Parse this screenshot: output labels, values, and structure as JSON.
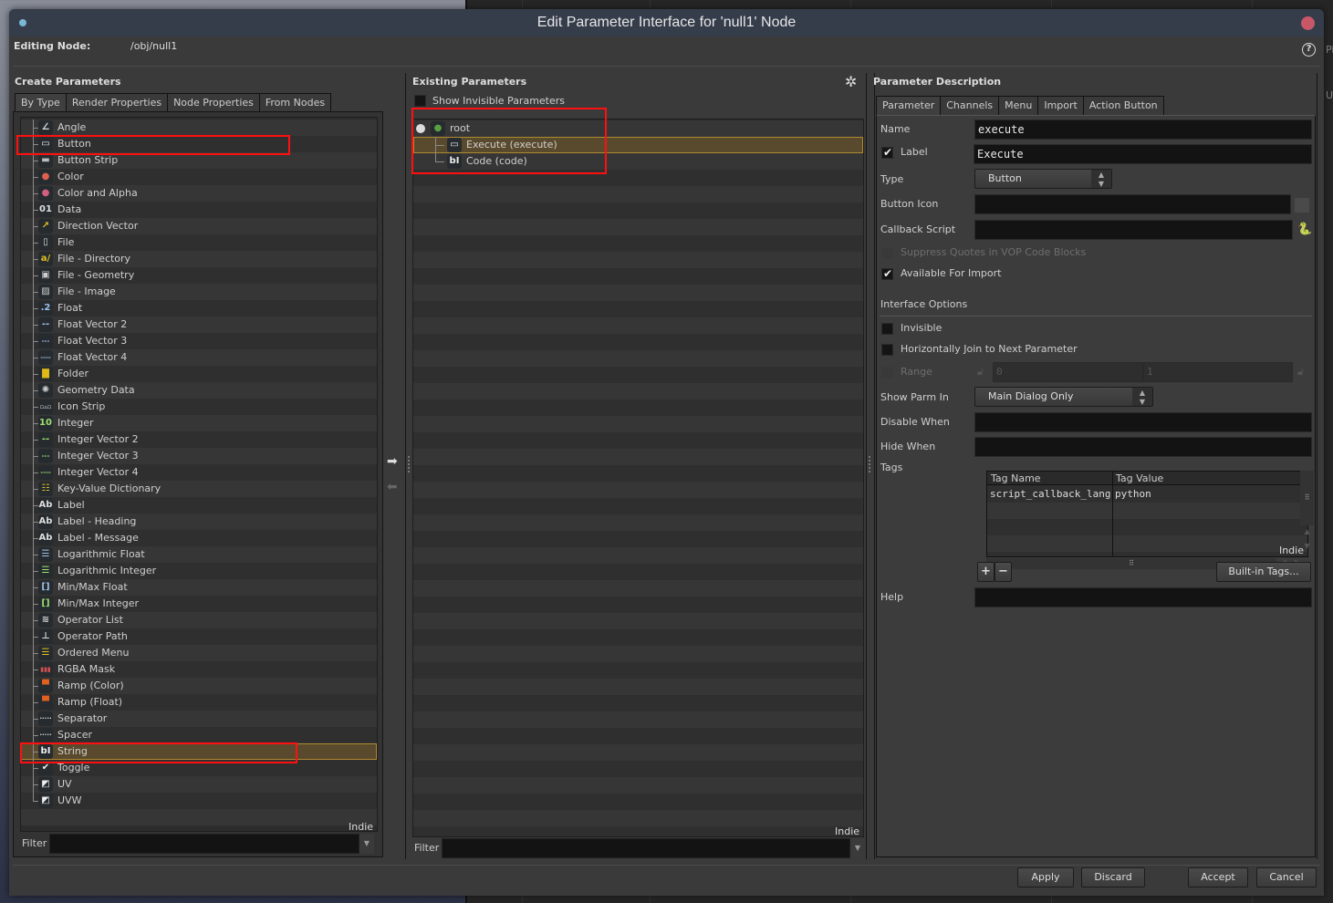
{
  "dialog": {
    "title": "Edit Parameter Interface for 'null1' Node",
    "editing_node_label": "Editing Node:",
    "editing_node_value": "/obj/null1",
    "help_icon": "?"
  },
  "background": {
    "side_text_1": "Pi",
    "side_text_2": "U"
  },
  "create_parameters": {
    "title": "Create Parameters",
    "tabs": [
      "By Type",
      "Render Properties",
      "Node Properties",
      "From Nodes"
    ],
    "active_tab": "By Type",
    "items": [
      {
        "label": "Angle",
        "icon": "angle-icon",
        "glyph": "∠",
        "color": "#ddd"
      },
      {
        "label": "Button",
        "icon": "button-icon",
        "glyph": "▭",
        "color": "#eee",
        "highlighted": true
      },
      {
        "label": "Button Strip",
        "icon": "button-strip-icon",
        "glyph": "▬",
        "color": "#bbb"
      },
      {
        "label": "Color",
        "icon": "color-icon",
        "glyph": "●",
        "color": "#e06050"
      },
      {
        "label": "Color and Alpha",
        "icon": "color-alpha-icon",
        "glyph": "●",
        "color": "#d06080"
      },
      {
        "label": "Data",
        "icon": "data-icon",
        "glyph": "01",
        "color": "#ddd"
      },
      {
        "label": "Direction Vector",
        "icon": "direction-vector-icon",
        "glyph": "↗",
        "color": "#e0c020"
      },
      {
        "label": "File",
        "icon": "file-icon",
        "glyph": "▯",
        "color": "#ddd"
      },
      {
        "label": "File - Directory",
        "icon": "file-directory-icon",
        "glyph": "a/",
        "color": "#e0c020"
      },
      {
        "label": "File - Geometry",
        "icon": "file-geometry-icon",
        "glyph": "▣",
        "color": "#ccc"
      },
      {
        "label": "File - Image",
        "icon": "file-image-icon",
        "glyph": "▨",
        "color": "#ccc"
      },
      {
        "label": "Float",
        "icon": "float-icon",
        "glyph": ".2",
        "color": "#9fc2e8"
      },
      {
        "label": "Float Vector 2",
        "icon": "float-vector2-icon",
        "glyph": "--",
        "color": "#9fc2e8"
      },
      {
        "label": "Float Vector 3",
        "icon": "float-vector3-icon",
        "glyph": "---",
        "color": "#9fc2e8"
      },
      {
        "label": "Float Vector 4",
        "icon": "float-vector4-icon",
        "glyph": "----",
        "color": "#9fc2e8"
      },
      {
        "label": "Folder",
        "icon": "folder-icon",
        "glyph": "▇",
        "color": "#e0b818"
      },
      {
        "label": "Geometry Data",
        "icon": "geometry-data-icon",
        "glyph": "✺",
        "color": "#ccc"
      },
      {
        "label": "Icon Strip",
        "icon": "icon-strip-icon",
        "glyph": "▫▵▫",
        "color": "#ddd"
      },
      {
        "label": "Integer",
        "icon": "integer-icon",
        "glyph": "10",
        "color": "#9ee070"
      },
      {
        "label": "Integer Vector 2",
        "icon": "integer-vector2-icon",
        "glyph": "--",
        "color": "#9ee070"
      },
      {
        "label": "Integer Vector 3",
        "icon": "integer-vector3-icon",
        "glyph": "---",
        "color": "#9ee070"
      },
      {
        "label": "Integer Vector 4",
        "icon": "integer-vector4-icon",
        "glyph": "----",
        "color": "#9ee070"
      },
      {
        "label": "Key-Value Dictionary",
        "icon": "key-value-dictionary-icon",
        "glyph": "☷",
        "color": "#e0c020"
      },
      {
        "label": "Label",
        "icon": "label-icon",
        "glyph": "Ab",
        "color": "#ddd"
      },
      {
        "label": "Label - Heading",
        "icon": "label-heading-icon",
        "glyph": "Ab",
        "color": "#ddd"
      },
      {
        "label": "Label - Message",
        "icon": "label-message-icon",
        "glyph": "Ab",
        "color": "#ddd"
      },
      {
        "label": "Logarithmic Float",
        "icon": "log-float-icon",
        "glyph": "☰",
        "color": "#9fc2e8"
      },
      {
        "label": "Logarithmic Integer",
        "icon": "log-integer-icon",
        "glyph": "☰",
        "color": "#9ee070"
      },
      {
        "label": "Min/Max Float",
        "icon": "minmax-float-icon",
        "glyph": "[]",
        "color": "#9fc2e8"
      },
      {
        "label": "Min/Max Integer",
        "icon": "minmax-integer-icon",
        "glyph": "[]",
        "color": "#9ee070"
      },
      {
        "label": "Operator List",
        "icon": "operator-list-icon",
        "glyph": "≋",
        "color": "#ddd"
      },
      {
        "label": "Operator Path",
        "icon": "operator-path-icon",
        "glyph": "⊥",
        "color": "#ddd"
      },
      {
        "label": "Ordered Menu",
        "icon": "ordered-menu-icon",
        "glyph": "☰",
        "color": "#e0c020"
      },
      {
        "label": "RGBA Mask",
        "icon": "rgba-mask-icon",
        "glyph": "▮▮▮",
        "color": "#d05050"
      },
      {
        "label": "Ramp (Color)",
        "icon": "ramp-color-icon",
        "glyph": "▀",
        "color": "#e06020"
      },
      {
        "label": "Ramp (Float)",
        "icon": "ramp-float-icon",
        "glyph": "▀",
        "color": "#e06020"
      },
      {
        "label": "Separator",
        "icon": "separator-icon",
        "glyph": "·····",
        "color": "#ddd"
      },
      {
        "label": "Spacer",
        "icon": "spacer-icon",
        "glyph": "·····",
        "color": "#ddd"
      },
      {
        "label": "String",
        "icon": "string-icon",
        "glyph": "bI",
        "color": "#eee",
        "selected": true,
        "highlighted": true
      },
      {
        "label": "Toggle",
        "icon": "toggle-icon",
        "glyph": "✔",
        "color": "#eee"
      },
      {
        "label": "UV",
        "icon": "uv-icon",
        "glyph": "◩",
        "color": "#eee"
      },
      {
        "label": "UVW",
        "icon": "uvw-icon",
        "glyph": "◩",
        "color": "#eee"
      }
    ],
    "indie_label": "Indie",
    "filter_label": "Filter",
    "filter_value": ""
  },
  "existing_parameters": {
    "title": "Existing Parameters",
    "show_invisible_label": "Show Invisible Parameters",
    "show_invisible_checked": false,
    "tree": [
      {
        "label": "root",
        "icon": "globe-icon",
        "glyph": "●",
        "color": "#5aa040",
        "depth": 0
      },
      {
        "label": "Execute (execute)",
        "icon": "button-icon",
        "glyph": "▭",
        "color": "#eee",
        "depth": 1,
        "selected": true
      },
      {
        "label": "Code (code)",
        "icon": "string-icon",
        "glyph": "bI",
        "color": "#eee",
        "depth": 1
      }
    ],
    "indie_label": "Indie",
    "filter_label": "Filter",
    "filter_value": ""
  },
  "parameter_description": {
    "title": "Parameter Description",
    "tabs": [
      "Parameter",
      "Channels",
      "Menu",
      "Import",
      "Action Button"
    ],
    "active_tab": "Parameter",
    "name_label": "Name",
    "name_value": "execute",
    "label_label": "Label",
    "label_checked": true,
    "label_value": "Execute",
    "type_label": "Type",
    "type_value": "Button",
    "button_icon_label": "Button Icon",
    "button_icon_value": "",
    "callback_label": "Callback Script",
    "callback_value": "",
    "suppress_quotes_label": "Suppress Quotes in VOP Code Blocks",
    "suppress_quotes_checked": false,
    "available_import_label": "Available For Import",
    "available_import_checked": true,
    "interface_options_label": "Interface Options",
    "invisible_label": "Invisible",
    "invisible_checked": false,
    "hjoin_label": "Horizontally Join to Next Parameter",
    "hjoin_checked": false,
    "range_label": "Range",
    "range_min": "0",
    "range_max": "1",
    "show_parm_in_label": "Show Parm In",
    "show_parm_in_value": "Main Dialog Only",
    "disable_when_label": "Disable When",
    "disable_when_value": "",
    "hide_when_label": "Hide When",
    "hide_when_value": "",
    "tags_label": "Tags",
    "tags_columns": [
      "Tag Name",
      "Tag Value"
    ],
    "tags_rows": [
      {
        "name": "script_callback_language",
        "value": "python"
      }
    ],
    "tags_indie": "Indie",
    "add_tag": "+",
    "remove_tag": "−",
    "builtin_tags_label": "Built-in Tags...",
    "help_label": "Help",
    "help_value": ""
  },
  "footer": {
    "apply": "Apply",
    "discard": "Discard",
    "accept": "Accept",
    "cancel": "Cancel"
  }
}
